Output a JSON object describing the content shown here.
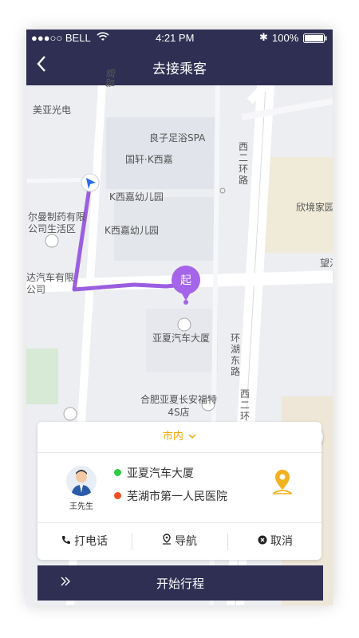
{
  "status_bar": {
    "carrier": "●●●○○ BELL",
    "time": "4:21 PM",
    "battery": "100%"
  },
  "nav": {
    "title": "去接乘客",
    "back_icon": "chevron-left-icon"
  },
  "map": {
    "roads": [
      "智路",
      "西二环路",
      "环湖东路",
      "望江"
    ],
    "labels": [
      "美亚光电",
      "良子足浴SPA",
      "国轩·K西嘉",
      "K西嘉幼儿园",
      "K西嘉幼儿园",
      "尔曼制药有限公司生活区",
      "达汽车有限公司",
      "欣境家园",
      "亚夏汽车大厦",
      "合肥亚夏长安福特4S店",
      "西二环"
    ],
    "pickup_marker": "起",
    "route_color": "#9b5ee0"
  },
  "trip_card": {
    "city_filter": "市内",
    "passenger_name": "王先生",
    "origin": "亚夏汽车大厦",
    "destination": "芜湖市第一人民医院",
    "origin_color": "#2ecc40",
    "destination_color": "#f04e23",
    "actions": {
      "call": "打电话",
      "navigate": "导航",
      "cancel": "取消"
    }
  },
  "start_button": {
    "label": "开始行程"
  }
}
